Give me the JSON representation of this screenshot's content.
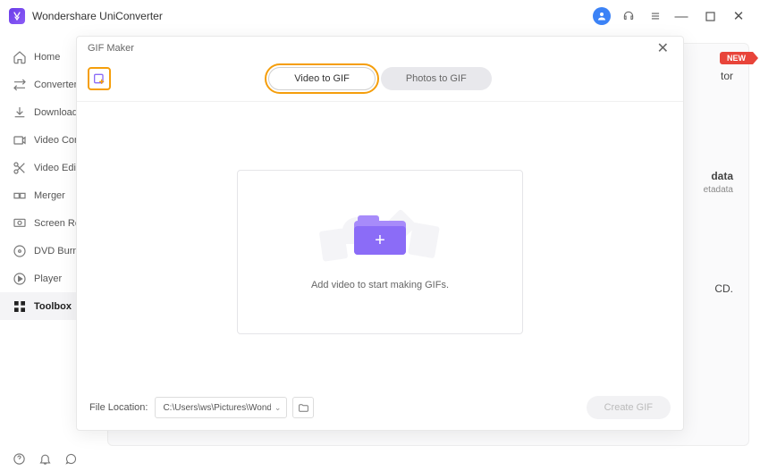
{
  "app": {
    "title": "Wondershare UniConverter"
  },
  "sidebar": {
    "items": [
      {
        "label": "Home"
      },
      {
        "label": "Converter"
      },
      {
        "label": "Downloader"
      },
      {
        "label": "Video Compressor"
      },
      {
        "label": "Video Editor"
      },
      {
        "label": "Merger"
      },
      {
        "label": "Screen Recorder"
      },
      {
        "label": "DVD Burner"
      },
      {
        "label": "Player"
      },
      {
        "label": "Toolbox"
      }
    ]
  },
  "background": {
    "new_badge": "NEW",
    "tor": "tor",
    "data": "data",
    "metadata": "etadata",
    "cd": "CD."
  },
  "modal": {
    "title": "GIF Maker",
    "tabs": {
      "video": "Video to GIF",
      "photos": "Photos to GIF"
    },
    "drop_text": "Add video to start making GIFs.",
    "footer": {
      "file_location_label": "File Location:",
      "path": "C:\\Users\\ws\\Pictures\\Wonders",
      "create_label": "Create GIF"
    }
  }
}
